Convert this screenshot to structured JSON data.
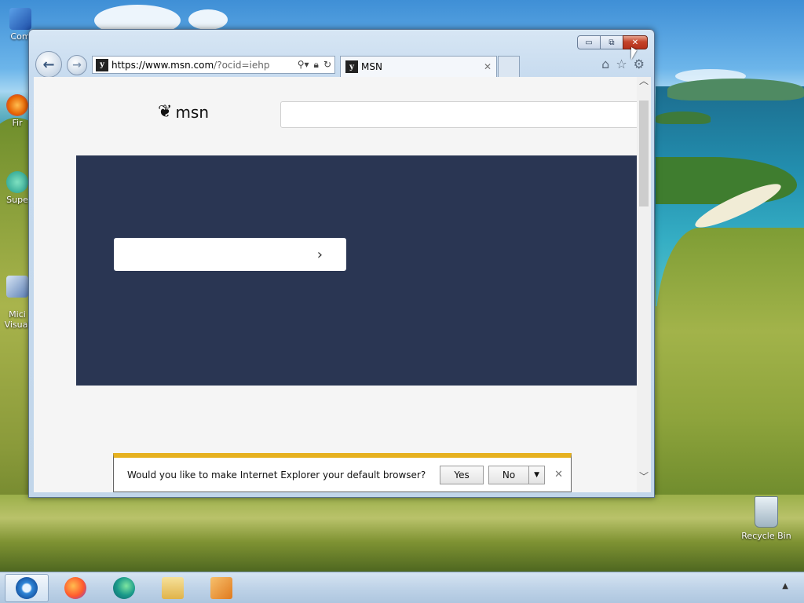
{
  "desktop": {
    "icons": [
      {
        "label": "Com",
        "name": "computer-icon"
      },
      {
        "label": "Fir",
        "name": "firefox-icon"
      },
      {
        "label": "Supe",
        "name": "super-icon"
      },
      {
        "label": "Mici\nVisual",
        "name": "visual-studio-icon"
      }
    ],
    "recycle_bin": "Recycle Bin"
  },
  "browser": {
    "window_buttons": {
      "minimize": "▭",
      "restore": "⧉",
      "close": "✕"
    },
    "address": {
      "host": "https://www.msn.com",
      "rest": "/?ocid=iehp"
    },
    "tab": {
      "title": "MSN",
      "close": "✕"
    },
    "toolbar": {
      "home": "⌂",
      "favorites": "☆",
      "tools": "⚙"
    },
    "page": {
      "logo_text": "msn",
      "hero_button_arrow": "›"
    }
  },
  "notification": {
    "message": "Would you like to make Internet Explorer your default browser?",
    "yes": "Yes",
    "no": "No",
    "dropdown": "▼",
    "close": "✕"
  },
  "taskbar": {
    "items": [
      "internet-explorer",
      "firefox",
      "edge",
      "file-explorer",
      "media-player"
    ],
    "tray_arrow": "▲"
  },
  "colors": {
    "hero_bg": "#2a3653",
    "notification_accent": "#e6b11f",
    "close_button": "#c4442a"
  }
}
